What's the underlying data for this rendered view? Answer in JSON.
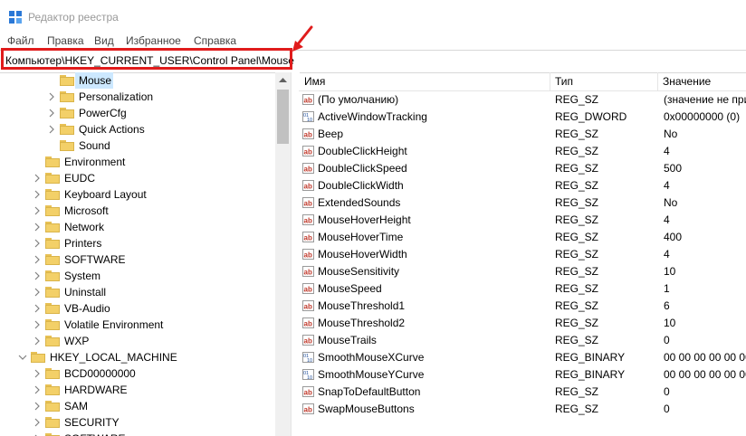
{
  "window": {
    "title": "Редактор реестра",
    "icon": "regedit-icon"
  },
  "menu": [
    "Файл",
    "Правка",
    "Вид",
    "Избранное",
    "Справка"
  ],
  "address": {
    "path": "Компьютер\\HKEY_CURRENT_USER\\Control Panel\\Mouse",
    "highlight_color": "#e01c1c"
  },
  "tree": {
    "items": [
      {
        "label": "Mouse",
        "level": 3,
        "expander": false,
        "selected": true
      },
      {
        "label": "Personalization",
        "level": 3,
        "expander": true
      },
      {
        "label": "PowerCfg",
        "level": 3,
        "expander": true
      },
      {
        "label": "Quick Actions",
        "level": 3,
        "expander": true
      },
      {
        "label": "Sound",
        "level": 3,
        "expander": false
      },
      {
        "label": "Environment",
        "level": 2,
        "expander": false
      },
      {
        "label": "EUDC",
        "level": 2,
        "expander": true
      },
      {
        "label": "Keyboard Layout",
        "level": 2,
        "expander": true
      },
      {
        "label": "Microsoft",
        "level": 2,
        "expander": true
      },
      {
        "label": "Network",
        "level": 2,
        "expander": true
      },
      {
        "label": "Printers",
        "level": 2,
        "expander": true
      },
      {
        "label": "SOFTWARE",
        "level": 2,
        "expander": true
      },
      {
        "label": "System",
        "level": 2,
        "expander": true
      },
      {
        "label": "Uninstall",
        "level": 2,
        "expander": true
      },
      {
        "label": "VB-Audio",
        "level": 2,
        "expander": true
      },
      {
        "label": "Volatile Environment",
        "level": 2,
        "expander": true
      },
      {
        "label": "WXP",
        "level": 2,
        "expander": true
      },
      {
        "label": "HKEY_LOCAL_MACHINE",
        "level": 1,
        "expander": true,
        "expanded": true
      },
      {
        "label": "BCD00000000",
        "level": 2,
        "expander": true
      },
      {
        "label": "HARDWARE",
        "level": 2,
        "expander": true
      },
      {
        "label": "SAM",
        "level": 2,
        "expander": true
      },
      {
        "label": "SECURITY",
        "level": 2,
        "expander": true
      },
      {
        "label": "SOFTWARE",
        "level": 2,
        "expander": true
      }
    ]
  },
  "list": {
    "columns": [
      "Имя",
      "Тип",
      "Значение"
    ],
    "rows": [
      {
        "name": "(По умолчанию)",
        "type": "REG_SZ",
        "value": "(значение не при",
        "icon": "string-value-icon"
      },
      {
        "name": "ActiveWindowTracking",
        "type": "REG_DWORD",
        "value": "0x00000000 (0)",
        "icon": "binary-value-icon"
      },
      {
        "name": "Beep",
        "type": "REG_SZ",
        "value": "No",
        "icon": "string-value-icon"
      },
      {
        "name": "DoubleClickHeight",
        "type": "REG_SZ",
        "value": "4",
        "icon": "string-value-icon"
      },
      {
        "name": "DoubleClickSpeed",
        "type": "REG_SZ",
        "value": "500",
        "icon": "string-value-icon"
      },
      {
        "name": "DoubleClickWidth",
        "type": "REG_SZ",
        "value": "4",
        "icon": "string-value-icon"
      },
      {
        "name": "ExtendedSounds",
        "type": "REG_SZ",
        "value": "No",
        "icon": "string-value-icon"
      },
      {
        "name": "MouseHoverHeight",
        "type": "REG_SZ",
        "value": "4",
        "icon": "string-value-icon"
      },
      {
        "name": "MouseHoverTime",
        "type": "REG_SZ",
        "value": "400",
        "icon": "string-value-icon"
      },
      {
        "name": "MouseHoverWidth",
        "type": "REG_SZ",
        "value": "4",
        "icon": "string-value-icon"
      },
      {
        "name": "MouseSensitivity",
        "type": "REG_SZ",
        "value": "10",
        "icon": "string-value-icon"
      },
      {
        "name": "MouseSpeed",
        "type": "REG_SZ",
        "value": "1",
        "icon": "string-value-icon"
      },
      {
        "name": "MouseThreshold1",
        "type": "REG_SZ",
        "value": "6",
        "icon": "string-value-icon"
      },
      {
        "name": "MouseThreshold2",
        "type": "REG_SZ",
        "value": "10",
        "icon": "string-value-icon"
      },
      {
        "name": "MouseTrails",
        "type": "REG_SZ",
        "value": "0",
        "icon": "string-value-icon"
      },
      {
        "name": "SmoothMouseXCurve",
        "type": "REG_BINARY",
        "value": "00 00 00 00 00 00 0",
        "icon": "binary-value-icon"
      },
      {
        "name": "SmoothMouseYCurve",
        "type": "REG_BINARY",
        "value": "00 00 00 00 00 00 0",
        "icon": "binary-value-icon"
      },
      {
        "name": "SnapToDefaultButton",
        "type": "REG_SZ",
        "value": "0",
        "icon": "string-value-icon"
      },
      {
        "name": "SwapMouseButtons",
        "type": "REG_SZ",
        "value": "0",
        "icon": "string-value-icon"
      }
    ]
  }
}
